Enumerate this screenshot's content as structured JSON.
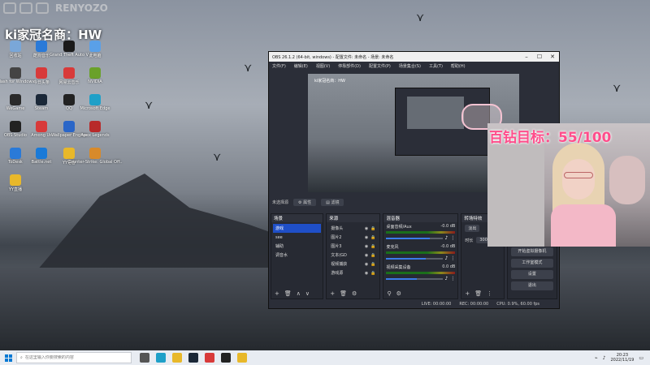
{
  "streamer_name": "ki家冠名商：HW",
  "watermark": "RENYOZO",
  "goal_text": "百钻目标：55/100",
  "desktop_icons": [
    {
      "label": "回收站",
      "color": "#7aa7d8"
    },
    {
      "label": "酷狗音乐",
      "color": "#2a7ad8"
    },
    {
      "label": "Grand Theft Auto V",
      "color": "#1a1a1a"
    },
    {
      "label": "此电脑",
      "color": "#5aa0e8"
    },
    {
      "label": "Clash for Windows",
      "color": "#444444"
    },
    {
      "label": "今日头条",
      "color": "#d83a3a"
    },
    {
      "label": "网易云音乐",
      "color": "#d83a3a"
    },
    {
      "label": "NVIDIA",
      "color": "#6aa12a"
    },
    {
      "label": "WeGame",
      "color": "#2a2a2a"
    },
    {
      "label": "Steam",
      "color": "#1b2838"
    },
    {
      "label": "QQ",
      "color": "#222222"
    },
    {
      "label": "Microsoft Edge",
      "color": "#1fa0c8"
    },
    {
      "label": "OBS Studio",
      "color": "#222222"
    },
    {
      "label": "Among Us",
      "color": "#d83a3a"
    },
    {
      "label": "Wallpaper Engine",
      "color": "#2a66c8"
    },
    {
      "label": "Apex Legends",
      "color": "#b82a2a"
    },
    {
      "label": "ToDesk",
      "color": "#2a7ad8"
    },
    {
      "label": "Battle.net",
      "color": "#1a7ad8"
    },
    {
      "label": "YY语音",
      "color": "#e8b82a"
    },
    {
      "label": "Counter-Strike: Global Off..",
      "color": "#d88a2a"
    },
    {
      "label": "YY直播",
      "color": "#e8b82a"
    }
  ],
  "obs": {
    "title": "OBS 26.1.2 (64-bit, windows) - 配置文件: 未命名 - 场景: 未命名",
    "menu": [
      "文件(F)",
      "编辑(E)",
      "视图(V)",
      "停靠部件(D)",
      "配置文件(P)",
      "场景集合(S)",
      "工具(T)",
      "帮助(H)"
    ],
    "preview_label": "ki家冠名商：HW",
    "scene_bar": {
      "label": "未选择源",
      "btn_properties": "属性",
      "btn_filters": "滤镜"
    },
    "scenes": {
      "title": "场景",
      "items": [
        "游戏",
        "see",
        "辅助",
        "调音水"
      ]
    },
    "sources": {
      "title": "来源",
      "items": [
        "摄像头",
        "图片2",
        "图片3",
        "文本(GD",
        "视频捕获",
        "游戏源"
      ]
    },
    "mixer": {
      "title": "混音器",
      "channels": [
        {
          "name": "桌面音频/Aux",
          "db": "-0.0 dB",
          "level": 0.78
        },
        {
          "name": "麦克风",
          "db": "-0.0 dB",
          "level": 0.7
        },
        {
          "name": "视频采集设备",
          "db": "0.0 dB",
          "level": 0.55
        }
      ]
    },
    "transitions": {
      "title": "转场特效",
      "type": "淡出",
      "duration_label": "时长",
      "duration": "300 ms"
    },
    "controls": [
      "开始虚拟摄像机",
      "工作室模式",
      "设置",
      "退出"
    ],
    "status": {
      "live": "LIVE: 00:00:00",
      "rec": "REC: 00:00:00",
      "cpu": "CPU: 0.9%, 60.00 fps"
    }
  },
  "taskbar": {
    "search_placeholder": "在这里输入你要搜索的内容",
    "time": "20:23",
    "date": "2022/11/19"
  }
}
